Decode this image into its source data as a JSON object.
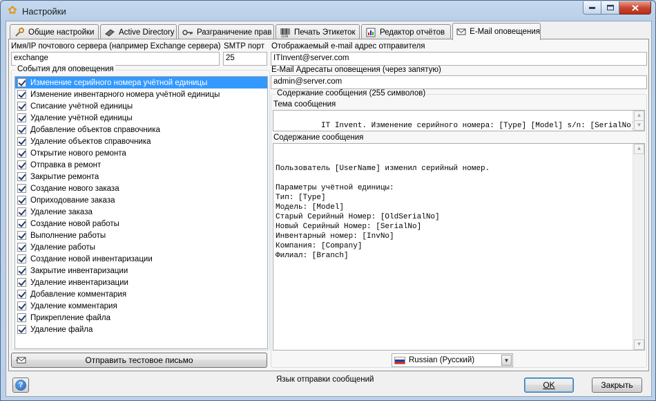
{
  "window": {
    "title": "Настройки",
    "icons": {
      "app": "gear-app-icon",
      "minimize": "minimize-icon",
      "maximize": "maximize-icon",
      "close": "close-icon"
    }
  },
  "tabs": [
    {
      "label": "Общие настройки",
      "icon": "tools-icon",
      "active": false
    },
    {
      "label": "Active Directory",
      "icon": "book-icon",
      "active": false
    },
    {
      "label": "Разграничение прав",
      "icon": "keys-icon",
      "active": false
    },
    {
      "label": "Печать Этикеток",
      "icon": "barcode-icon",
      "active": false
    },
    {
      "label": "Редактор отчётов",
      "icon": "report-icon",
      "active": false
    },
    {
      "label": "E-Mail оповещения",
      "icon": "email-icon",
      "active": true
    }
  ],
  "email": {
    "server_label": "Имя/IP почтового сервера (например Exchange сервера)",
    "server_value": "exchange",
    "port_label": "SMTP порт",
    "port_value": "25",
    "sender_label": "Отображаемый e-mail адрес отправителя",
    "sender_value": "ITInvent@server.com",
    "recipients_label": "E-Mail Адресаты оповещения (через запятую)",
    "recipients_value": "admin@server.com"
  },
  "events": {
    "title": "События для оповещения",
    "items": [
      "Изменение серийного номера учётной единицы",
      "Изменение инвентарного номера учётной единицы",
      "Списание учётной единицы",
      "Удаление учётной единицы",
      "Добавление объектов справочника",
      "Удаление объектов справочника",
      "Открытие нового ремонта",
      "Отправка в ремонт",
      "Закрытие ремонта",
      "Создание нового заказа",
      "Оприходование заказа",
      "Удаление заказа",
      "Создание новой работы",
      "Выполнение работы",
      "Удаление работы",
      "Создание новой инвентаризации",
      "Закрытие инвентаризации",
      "Удаление инвентаризации",
      "Добавление комментария",
      "Удаление комментария",
      "Прикрепление файла",
      "Удаление файла"
    ],
    "selected_index": 0,
    "test_button": "Отправить тестовое письмо"
  },
  "message": {
    "group_title": "Содержание сообщения (255 символов)",
    "subject_label": "Тема сообщения",
    "subject_value": "IT Invent. Изменение серийного номера: [Type] [Model] s/n: [SerialNo]",
    "body_label": "Содержание сообщения",
    "body_lines": [
      "Пользователь [UserName] изменил серийный номер.",
      "",
      "Параметры учётной единицы:",
      "Тип: [Type]",
      "Модель: [Model]",
      "Старый Серийный Номер: [OldSerialNo]",
      "Новый Серийный Номер: [SerialNo]",
      "Инвентарный номер: [InvNo]",
      "Компания: [Company]",
      "Филиал: [Branch]"
    ],
    "language_label": "Язык отправки сообщений",
    "language_value": "Russian (Русский)"
  },
  "footer": {
    "help": "?",
    "ok": "OK",
    "close": "Закрыть"
  }
}
